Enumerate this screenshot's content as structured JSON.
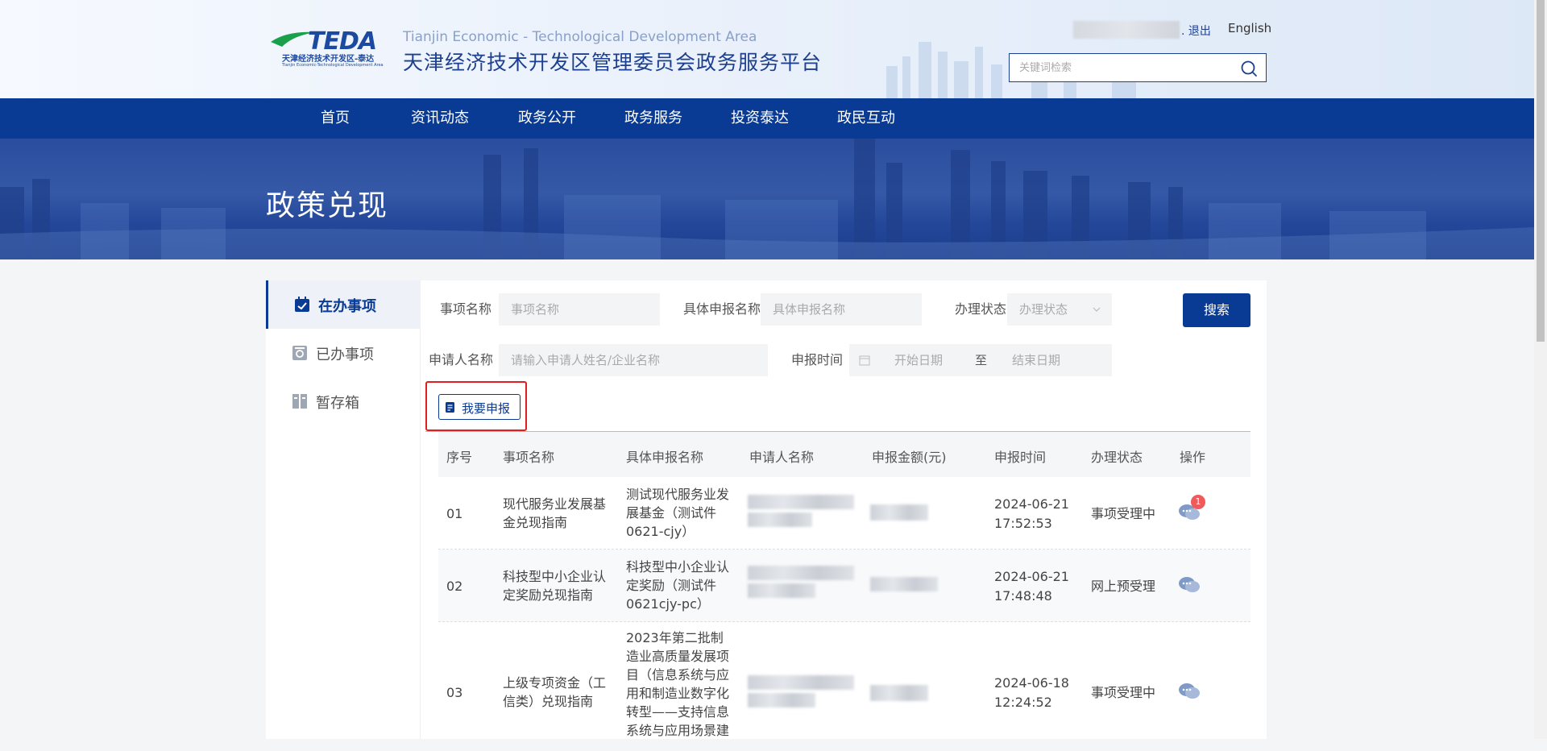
{
  "header": {
    "site_en": "Tianjin Economic - Technological Development Area",
    "site_cn": "天津经济技术开发区管理委员会政务服务平台",
    "logo_word": "TEDA",
    "logo_cn": "天津经济技术开发区-泰达",
    "logo_en": "Tianjin Economic-Technological Development Area",
    "logout": ". 退出",
    "english": "English",
    "search_placeholder": "关键词检索"
  },
  "nav": [
    "首页",
    "资讯动态",
    "政务公开",
    "政务服务",
    "投资泰达",
    "政民互动"
  ],
  "banner": {
    "title": "政策兑现"
  },
  "sidebar": [
    {
      "label": "在办事项",
      "icon": "calendar-check-icon",
      "active": true
    },
    {
      "label": "已办事项",
      "icon": "archive-icon",
      "active": false
    },
    {
      "label": "暂存箱",
      "icon": "file-cabinet-icon",
      "active": false
    }
  ],
  "filters": {
    "item_name_label": "事项名称",
    "item_name_placeholder": "事项名称",
    "report_name_label": "具体申报名称",
    "report_name_placeholder": "具体申报名称",
    "status_label": "办理状态",
    "status_placeholder": "办理状态",
    "search_button": "搜索",
    "applicant_label": "申请人名称",
    "applicant_placeholder": "请输入申请人姓名/企业名称",
    "time_label": "申报时间",
    "start_placeholder": "开始日期",
    "range_sep": "至",
    "end_placeholder": "结束日期"
  },
  "report_button": "我要申报",
  "table": {
    "headers": [
      "序号",
      "事项名称",
      "具体申报名称",
      "申请人名称",
      "申报金额(元)",
      "申报时间",
      "办理状态",
      "操作"
    ],
    "rows": [
      {
        "no": "01",
        "item": "现代服务业发展基金兑现指南",
        "report": "测试现代服务业发展基金（测试件0621-cjy）",
        "date": "2024-06-21",
        "time": "17:52:53",
        "status": "事项受理中",
        "badge": "1"
      },
      {
        "no": "02",
        "item": "科技型中小企业认定奖励兑现指南",
        "report": "科技型中小企业认定奖励（测试件0621cjy-pc）",
        "date": "2024-06-21",
        "time": "17:48:48",
        "status": "网上预受理",
        "badge": ""
      },
      {
        "no": "03",
        "item": "上级专项资金（工信类）兑现指南",
        "report": "2023年第二批制造业高质量发展项目（信息系统与应用和制造业数字化转型——支持信息系统与应用场景建",
        "date": "2024-06-18",
        "time": "12:24:52",
        "status": "事项受理中",
        "badge": ""
      }
    ]
  },
  "colors": {
    "primary": "#0a3b94",
    "accent_red": "#e02020",
    "badge": "#f05a5a"
  }
}
